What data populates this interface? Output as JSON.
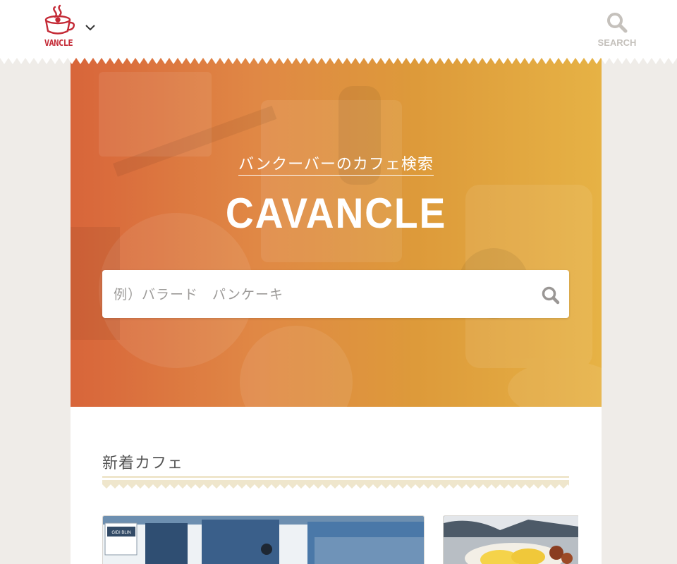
{
  "header": {
    "logo_text": "VANCLE",
    "search_label": "SEARCH"
  },
  "hero": {
    "subtitle": "バンクーバーのカフェ検索",
    "title": "CAVANCLE",
    "search_placeholder": "例）バラード　パンケーキ"
  },
  "new_cafes": {
    "heading": "新着カフェ",
    "cards": [
      {
        "image": "cafe-storefront-photo",
        "sign_text": "GIDI BLIN"
      },
      {
        "image": "eggs-benedict-photo"
      }
    ]
  },
  "colors": {
    "brand_red": "#c42a36",
    "hero_gradient_start": "#d8653a",
    "hero_gradient_end": "#e6b245",
    "page_bg": "#efece8",
    "rule_cream": "#efe6cc"
  }
}
